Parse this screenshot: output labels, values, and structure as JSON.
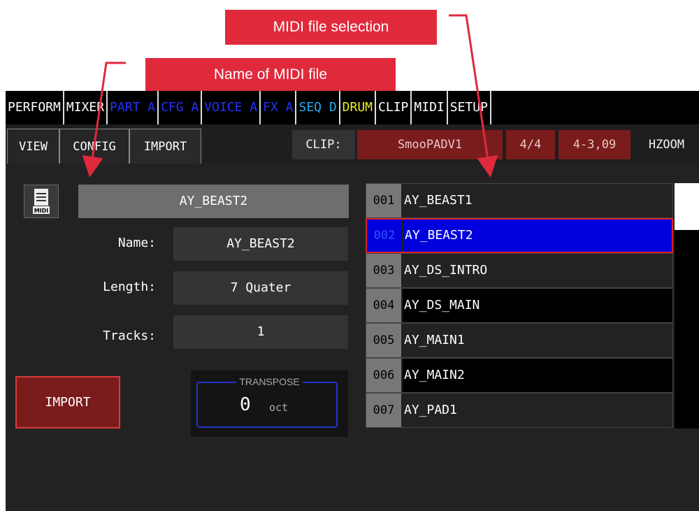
{
  "callouts": {
    "midi_file_selection": "MIDI file selection",
    "name_of_midi_file": "Name of MIDI file"
  },
  "menu": [
    {
      "label": "PERFORM",
      "color": "#ffffff"
    },
    {
      "label": "MIXER",
      "color": "#ffffff"
    },
    {
      "label": "PART A",
      "color": "#2233ff"
    },
    {
      "label": "CFG A",
      "color": "#2233ff"
    },
    {
      "label": "VOICE A",
      "color": "#2233ff"
    },
    {
      "label": "FX A",
      "color": "#2233ff"
    },
    {
      "label": "SEQ D",
      "color": "#22aaee"
    },
    {
      "label": "DRUM",
      "color": "#eeee22"
    },
    {
      "label": "CLIP",
      "color": "#ffffff"
    },
    {
      "label": "MIDI",
      "color": "#ffffff"
    },
    {
      "label": "SETUP",
      "color": "#ffffff"
    }
  ],
  "subtabs": {
    "view": "VIEW",
    "config": "CONFIG",
    "import": "IMPORT"
  },
  "header": {
    "clip_label": "CLIP:",
    "clip_name": "SmooPADV1",
    "time_signature": "4/4",
    "position": "4-3,09",
    "hzoom": "HZOOM"
  },
  "file_panel": {
    "icon_label": "MIDI",
    "selected_file": "AY_BEAST2",
    "name_label": "Name:",
    "name_value": "AY_BEAST2",
    "length_label": "Length:",
    "length_value": "7 Quater",
    "tracks_label": "Tracks:",
    "tracks_value": "1",
    "import_button": "IMPORT"
  },
  "transpose": {
    "title": "TRANSPOSE",
    "value": "0",
    "unit": "oct"
  },
  "files": [
    {
      "num": "001",
      "name": "AY_BEAST1",
      "style": "dark"
    },
    {
      "num": "002",
      "name": "AY_BEAST2",
      "style": "sel"
    },
    {
      "num": "003",
      "name": "AY_DS_INTRO",
      "style": "dark"
    },
    {
      "num": "004",
      "name": "AY_DS_MAIN",
      "style": "black"
    },
    {
      "num": "005",
      "name": "AY_MAIN1",
      "style": "dark"
    },
    {
      "num": "006",
      "name": "AY_MAIN2",
      "style": "black"
    },
    {
      "num": "007",
      "name": "AY_PAD1",
      "style": "dark"
    }
  ],
  "scroll_position": 0.0
}
